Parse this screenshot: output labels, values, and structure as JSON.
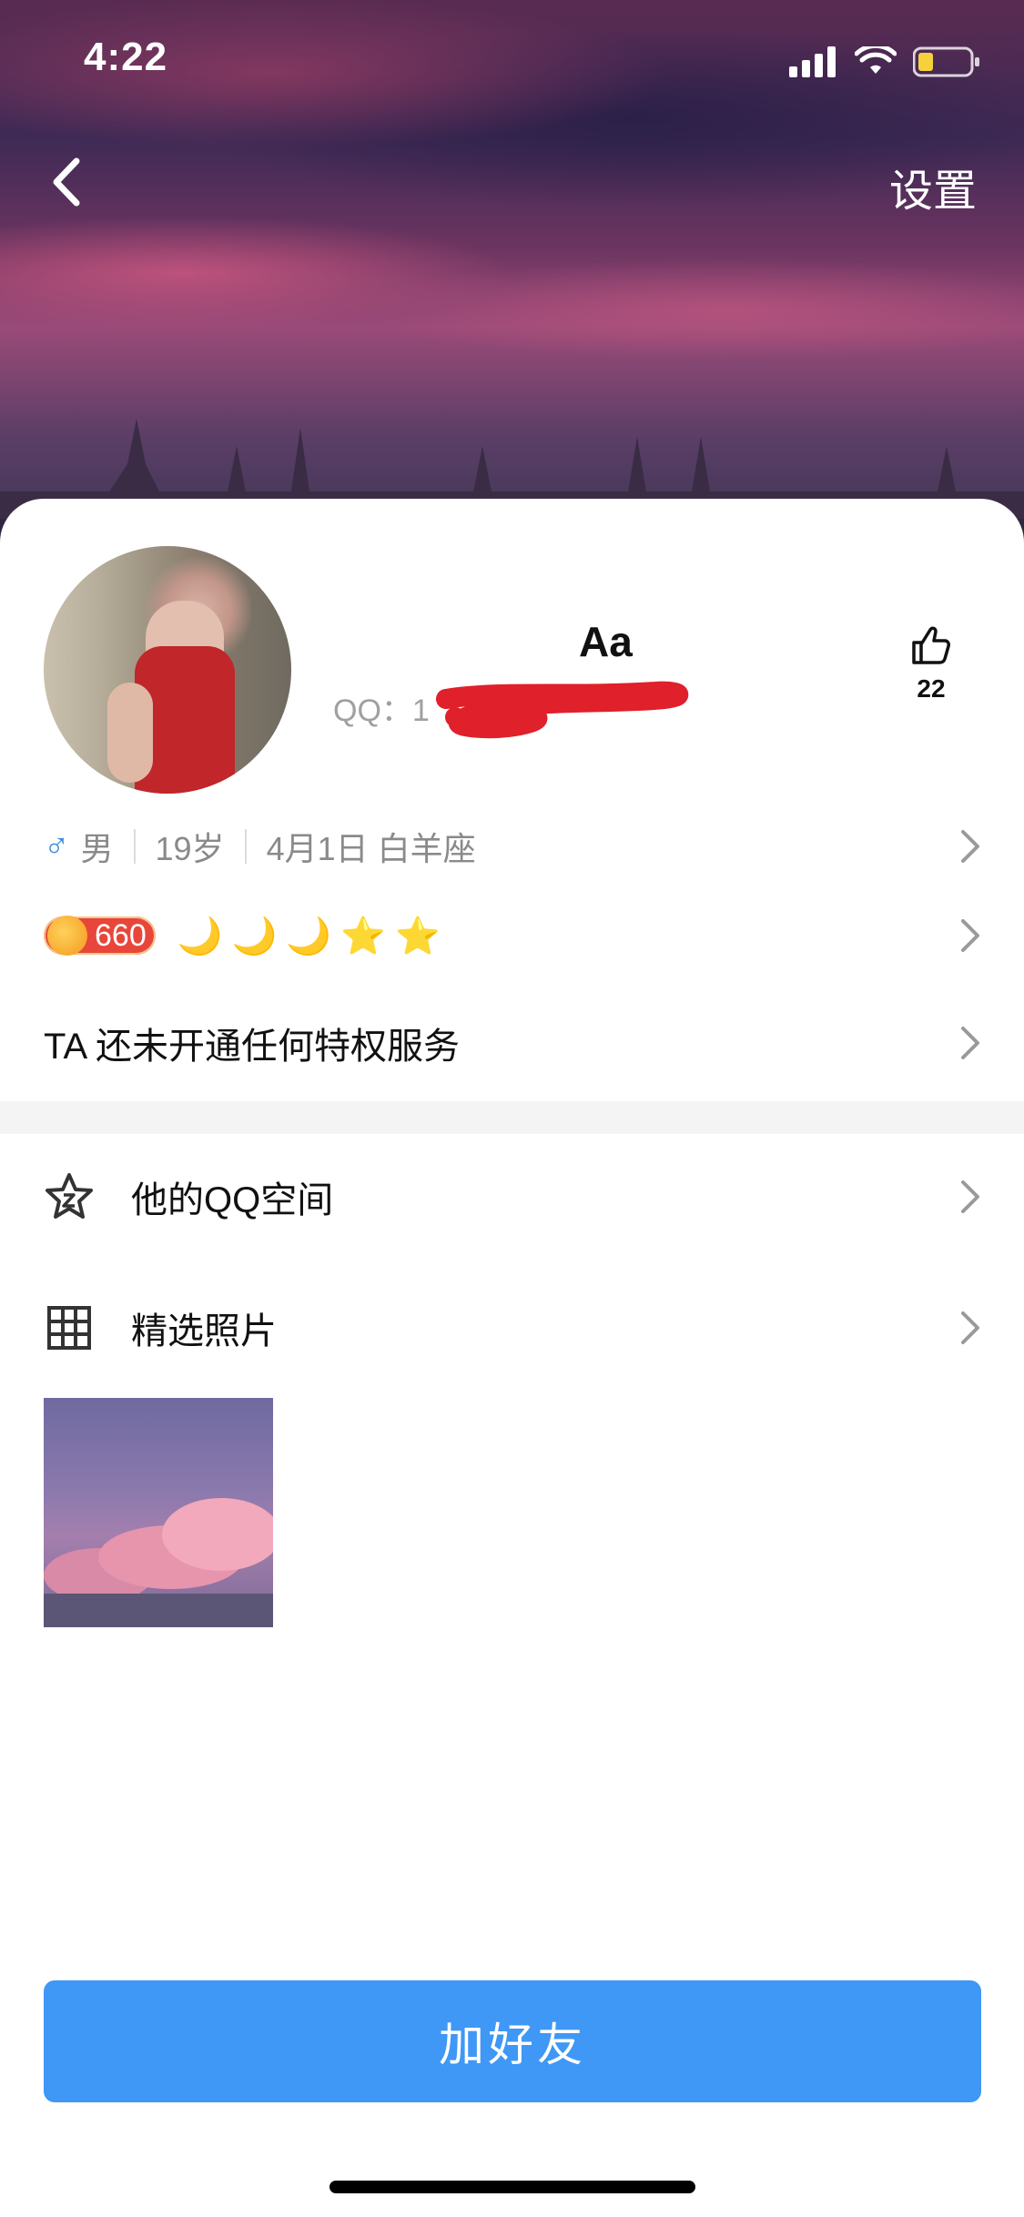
{
  "status_bar": {
    "time": "4:22"
  },
  "header": {
    "settings_label": "设置"
  },
  "profile": {
    "nickname": "Aa",
    "qq_prefix": "QQ：1",
    "like_count": "22",
    "gender": "男",
    "age": "19岁",
    "birthday_sign": "4月1日  白羊座",
    "level_number": "660",
    "level_icons": [
      "moon-icon",
      "moon-icon",
      "moon-icon",
      "star-icon",
      "star-icon"
    ],
    "vip_text": "TA 还未开通任何特权服务"
  },
  "menu": {
    "qzone_label": "他的QQ空间",
    "photos_label": "精选照片"
  },
  "actions": {
    "add_friend_label": "加好友"
  },
  "colors": {
    "accent": "#3f97f6",
    "gender": "#3a8ee6",
    "badge": "#e8463a"
  }
}
